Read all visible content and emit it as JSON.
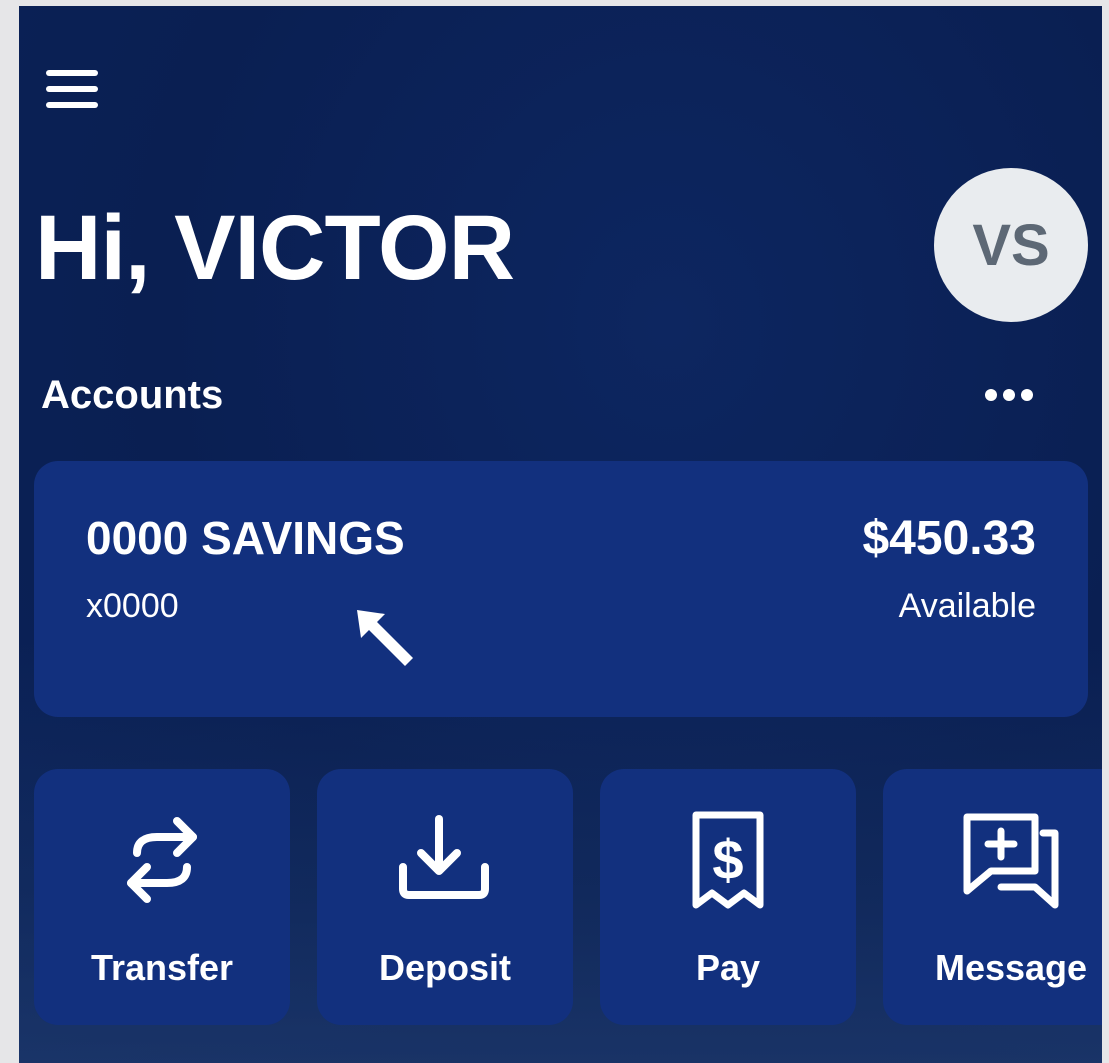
{
  "header": {
    "greeting": "Hi, VICTOR",
    "avatar_initials": "VS"
  },
  "accounts": {
    "section_title": "Accounts",
    "more_icon": "more-horizontal-icon",
    "items": [
      {
        "name": "0000 SAVINGS",
        "number": "x0000",
        "balance": "$450.33",
        "balance_label": "Available"
      }
    ]
  },
  "actions": [
    {
      "label": "Transfer",
      "icon": "transfer-icon"
    },
    {
      "label": "Deposit",
      "icon": "deposit-icon"
    },
    {
      "label": "Pay",
      "icon": "pay-icon"
    },
    {
      "label": "Message",
      "icon": "message-icon"
    }
  ],
  "colors": {
    "background": "#0a1f52",
    "card": "#12307e",
    "avatar_bg": "#e9ecef",
    "avatar_text": "#5d6875"
  }
}
